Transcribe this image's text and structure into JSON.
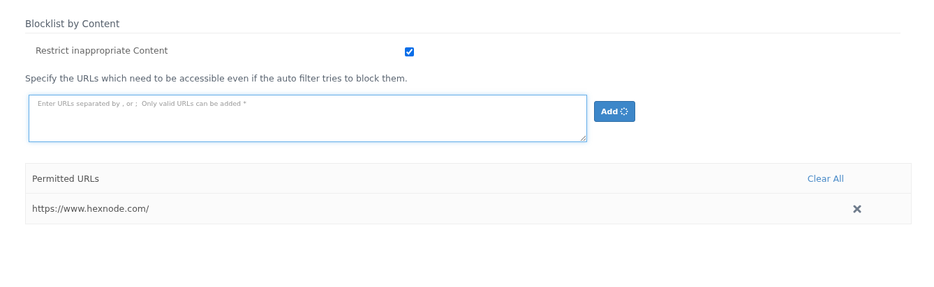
{
  "section": {
    "title": "Blocklist by Content"
  },
  "restrict": {
    "label": "Restrict inappropriate Content",
    "checked": true
  },
  "description": "Specify the URLs which need to be accessible even if the auto filter tries to block them.",
  "url_input": {
    "placeholder": "Enter URLs separated by , or ;  Only valid URLs can be added *"
  },
  "add_button": {
    "label": "Add",
    "loading": true
  },
  "table": {
    "heading": "Permitted URLs",
    "clear_label": "Clear All",
    "rows": [
      {
        "url": "https://www.hexnode.com/"
      }
    ]
  }
}
